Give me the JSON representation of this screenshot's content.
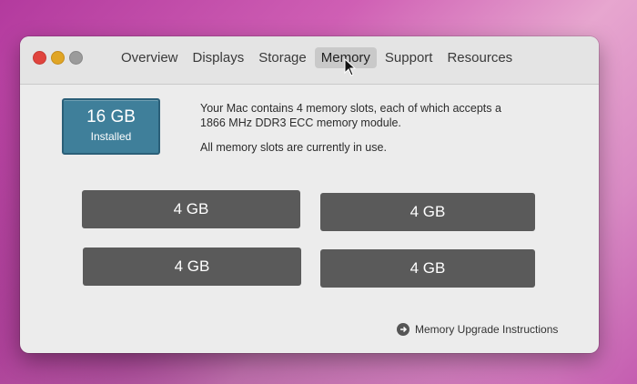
{
  "window": {
    "traffic_lights": [
      "close-icon",
      "minimize-icon",
      "zoom-icon"
    ],
    "tabs": [
      {
        "label": "Overview"
      },
      {
        "label": "Displays"
      },
      {
        "label": "Storage"
      },
      {
        "label": "Memory",
        "active": true
      },
      {
        "label": "Support"
      },
      {
        "label": "Resources"
      }
    ]
  },
  "memory": {
    "installed_amount": "16 GB",
    "installed_label": "Installed",
    "description": "Your Mac contains 4 memory slots, each of which accepts a 1866 MHz DDR3 ECC memory module.",
    "status": "All memory slots are currently in use.",
    "slots": [
      "4 GB",
      "4 GB",
      "4 GB",
      "4 GB"
    ],
    "upgrade_link": "Memory Upgrade Instructions"
  },
  "colors": {
    "installed_box": "#3f7f9a",
    "slot": "#5a5a5a",
    "active_tab": "#c9c9c9"
  }
}
